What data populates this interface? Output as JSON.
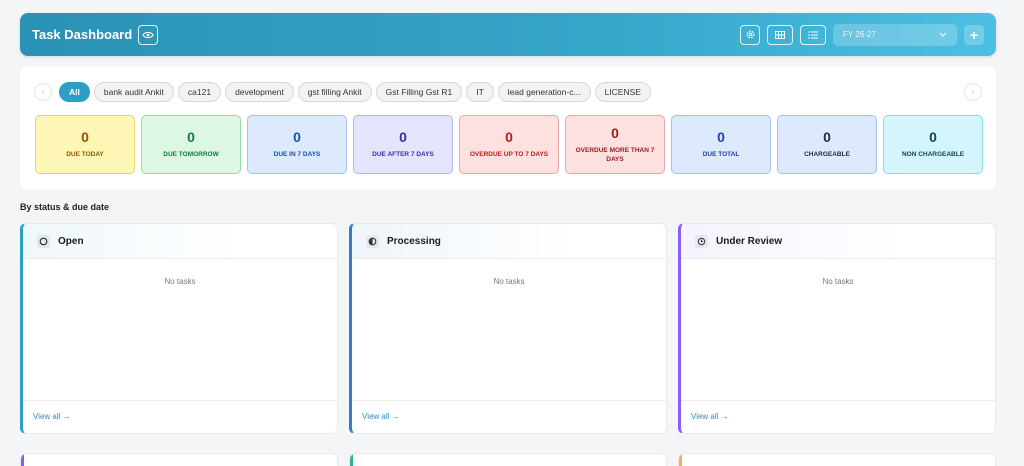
{
  "header": {
    "title": "Task Dashboard",
    "icons": [
      "eye-icon",
      "gear-icon",
      "grid-view-icon",
      "list-view-icon"
    ],
    "fy_select": "FY 26-27",
    "add_label": "+"
  },
  "tags": {
    "items": [
      "All",
      "bank audit Ankit",
      "ca121",
      "development",
      "gst filling Ankit",
      "Gst Filling Gst R1",
      "IT",
      "lead generation-c...",
      "LICENSE"
    ],
    "active": "All"
  },
  "stats": [
    {
      "value": "0",
      "label": "DUE TODAY",
      "bg": "#fdf6b5",
      "border": "#e6d56c",
      "color": "#8a5a00"
    },
    {
      "value": "0",
      "label": "DUE TOMORROW",
      "bg": "#dcf7e4",
      "border": "#92dba9",
      "color": "#167a3a"
    },
    {
      "value": "0",
      "label": "DUE IN 7 DAYS",
      "bg": "#dde9fd",
      "border": "#a3bff0",
      "color": "#1d4fa8"
    },
    {
      "value": "0",
      "label": "DUE AFTER 7 DAYS",
      "bg": "#e4e4fd",
      "border": "#b3b3ef",
      "color": "#3730a3"
    },
    {
      "value": "0",
      "label": "OVERDUE UP TO 7 DAYS",
      "bg": "#fde0e0",
      "border": "#eea5a5",
      "color": "#b91c1c"
    },
    {
      "value": "0",
      "label": "OVERDUE MORE THAN 7 DAYS",
      "bg": "#fde0e0",
      "border": "#eea5a5",
      "color": "#991b1b"
    },
    {
      "value": "0",
      "label": "DUE TOTAL",
      "bg": "#dde9fd",
      "border": "#a3bff0",
      "color": "#1e40af"
    },
    {
      "value": "0",
      "label": "CHARGEABLE",
      "bg": "#dde9fd",
      "border": "#a3bff0",
      "color": "#1f2a44"
    },
    {
      "value": "0",
      "label": "NON CHARGEABLE",
      "bg": "#d3f5fb",
      "border": "#8edbe8",
      "color": "#0f4654"
    }
  ],
  "section_title": "By status & due date",
  "columns": [
    {
      "title": "Open",
      "icon": "circle-icon",
      "empty": "No tasks",
      "footer": "View all →",
      "accent": "#2c9fc8"
    },
    {
      "title": "Processing",
      "icon": "half-circle-icon",
      "empty": "No tasks",
      "footer": "View all →",
      "accent": "#2c7fc8"
    },
    {
      "title": "Under Review",
      "icon": "clock-icon",
      "empty": "No tasks",
      "footer": "View all →",
      "accent": "#8b5cf6"
    }
  ],
  "bottom_accents": [
    "#8b5cf6",
    "#2fb39a",
    "#f0b54a"
  ]
}
